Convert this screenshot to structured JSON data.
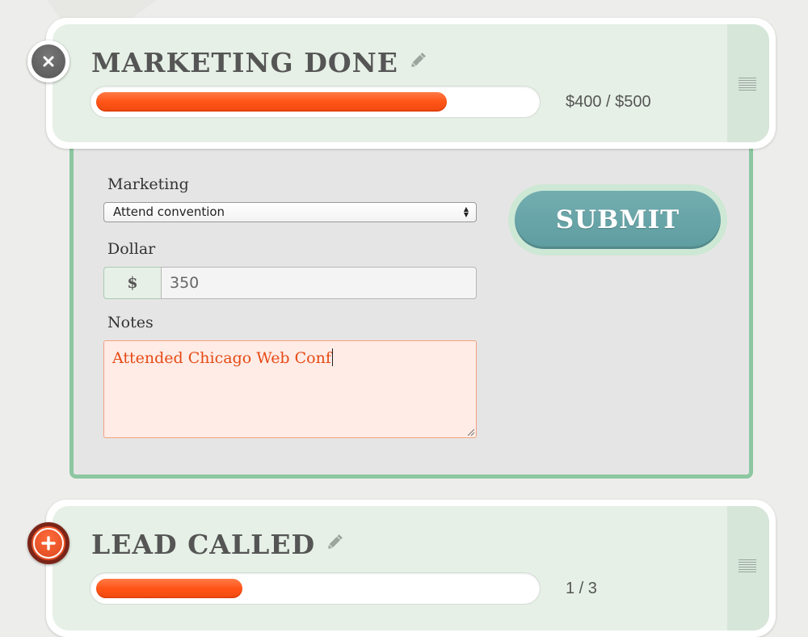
{
  "goals": [
    {
      "title": "MARKETING DONE",
      "progress_text": "$400 / $500",
      "progress_fraction": 0.8,
      "toggle_icon": "close-icon",
      "edit_icon": "pencil-icon",
      "handle_icon": "drag-handle-icon"
    },
    {
      "title": "LEAD CALLED",
      "progress_text": "1 / 3",
      "progress_fraction": 0.3333,
      "toggle_icon": "plus-icon",
      "edit_icon": "pencil-icon",
      "handle_icon": "drag-handle-icon"
    }
  ],
  "form": {
    "category_label": "Marketing",
    "category_selected": "Attend convention",
    "dollar_label": "Dollar",
    "dollar_prefix": "$",
    "dollar_value": "350",
    "notes_label": "Notes",
    "notes_value": "Attended Chicago Web Conf",
    "submit_label": "SUBMIT"
  },
  "colors": {
    "accent_orange": "#ff5417",
    "submit_teal": "#5e9da0",
    "panel_border_green": "#8cc7a1",
    "card_green": "#e6f0e6"
  }
}
